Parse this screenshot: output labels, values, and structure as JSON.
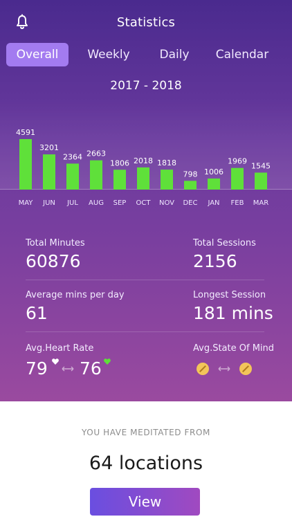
{
  "header": {
    "title": "Statistics",
    "bell_icon": "bell-icon"
  },
  "tabs": [
    {
      "label": "Overall",
      "active": true
    },
    {
      "label": "Weekly",
      "active": false
    },
    {
      "label": "Daily",
      "active": false
    },
    {
      "label": "Calendar",
      "active": false
    }
  ],
  "period": "2017 - 2018",
  "chart_data": {
    "type": "bar",
    "categories": [
      "MAY",
      "JUN",
      "JUL",
      "AUG",
      "SEP",
      "OCT",
      "NOV",
      "DEC",
      "JAN",
      "FEB",
      "MAR"
    ],
    "values": [
      4591,
      3201,
      2364,
      2663,
      1806,
      2018,
      1818,
      798,
      1006,
      1969,
      1545
    ],
    "value_labels": [
      "4591",
      "3201",
      "2364",
      "2663",
      "1806",
      "2018",
      "1818",
      "798",
      "1006",
      "1969",
      "1545"
    ],
    "title": "2017 - 2018",
    "xlabel": "",
    "ylabel": "",
    "ylim": [
      0,
      4591
    ],
    "bar_color": "#5fe03a",
    "grid": false
  },
  "stats": {
    "total_minutes_label": "Total Minutes",
    "total_minutes_value": "60876",
    "total_sessions_label": "Total Sessions",
    "total_sessions_value": "2156",
    "avg_mins_label": "Average mins per day",
    "avg_mins_value": "61",
    "longest_session_label": "Longest Session",
    "longest_session_value": "181 mins",
    "heart_rate_label": "Avg.Heart Rate",
    "heart_rate_before": "79",
    "heart_rate_after": "76",
    "state_of_mind_label": "Avg.State Of Mind"
  },
  "colors": {
    "accent_tab": "#a37bf0",
    "bar": "#5fe03a",
    "heart_before": "#ffffff",
    "heart_after": "#5fe03a",
    "mood": "#f3c55a"
  },
  "locations": {
    "intro": "YOU HAVE MEDITATED FROM",
    "value": "64 locations",
    "button_label": "View"
  }
}
